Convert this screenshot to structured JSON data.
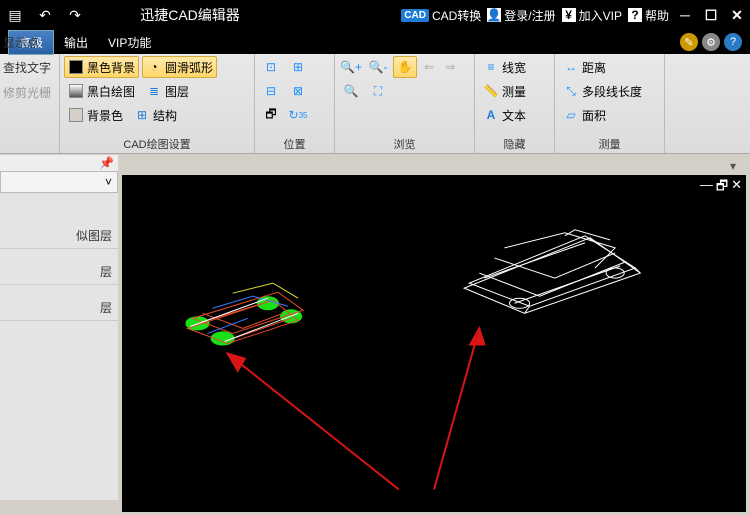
{
  "title": "迅捷CAD编辑器",
  "titlebar_links": {
    "cad_convert": "CAD转换",
    "login": "登录/注册",
    "vip": "加入VIP",
    "help": "帮助"
  },
  "cad_badge": "CAD",
  "tabs": {
    "advanced": "高级",
    "output": "输出",
    "vip": "VIP功能"
  },
  "side_items": {
    "show_point": "显示点",
    "find_text": "查找文字",
    "trim_grid": "修剪光栅"
  },
  "ribbon": {
    "draw_set_label": "CAD绘图设置",
    "pos_label": "位置",
    "browse_label": "浏览",
    "hide_label": "隐藏",
    "measure_label": "测量",
    "bg_black": "黑色背景",
    "bg_bw": "黑白绘图",
    "bg_color": "背景色",
    "smooth_arc": "圆滑弧形",
    "layers": "图层",
    "structure": "结构",
    "line_width": "线宽",
    "measure": "测量",
    "text": "文本",
    "distance": "距离",
    "poly_len": "多段线长度",
    "area": "面积"
  },
  "left_panel": {
    "items": [
      "似图层",
      "层",
      "层"
    ]
  }
}
